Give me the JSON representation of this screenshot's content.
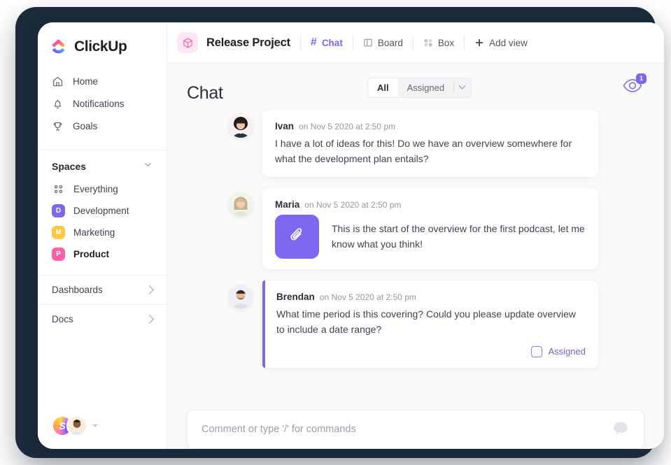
{
  "brand": {
    "name": "ClickUp",
    "accent": "#7b68ee",
    "pink": "#ff5fa8"
  },
  "sidebar": {
    "nav": [
      {
        "label": "Home",
        "icon": "home-icon"
      },
      {
        "label": "Notifications",
        "icon": "bell-icon"
      },
      {
        "label": "Goals",
        "icon": "trophy-icon"
      }
    ],
    "spaces_title": "Spaces",
    "spaces": [
      {
        "label": "Everything",
        "badge": "",
        "color": "",
        "icon": "grid-dots-icon",
        "active": false
      },
      {
        "label": "Development",
        "badge": "D",
        "color": "#7b68ee",
        "active": false
      },
      {
        "label": "Marketing",
        "badge": "M",
        "color": "#ffc93d",
        "active": false
      },
      {
        "label": "Product",
        "badge": "P",
        "color": "#ff5fa8",
        "active": true
      }
    ],
    "footer_links": [
      {
        "label": "Dashboards"
      },
      {
        "label": "Docs"
      }
    ],
    "user_avatar_initial": "S"
  },
  "topbar": {
    "project": "Release Project",
    "project_icon": "cube-icon",
    "tabs": [
      {
        "label": "Chat",
        "icon": "hash-icon",
        "active": true
      },
      {
        "label": "Board",
        "icon": "board-icon",
        "active": false
      },
      {
        "label": "Box",
        "icon": "box-grid-icon",
        "active": false
      }
    ],
    "add_view": "Add view"
  },
  "page": {
    "title": "Chat",
    "filters": [
      {
        "label": "All",
        "selected": true
      },
      {
        "label": "Assigned",
        "selected": false
      }
    ],
    "watchers": {
      "icon": "eye-icon",
      "count": "1"
    }
  },
  "messages": [
    {
      "author": "Ivan",
      "stamp": "on Nov 5 2020 at 2:50 pm",
      "text": "I have a lot of ideas for this! Do we have an overview somewhere for what the development plan entails?",
      "avatar_bg": "#fbeff1",
      "accent": false,
      "attachment": null,
      "assigned_label": null
    },
    {
      "author": "Maria",
      "stamp": "on Nov 5 2020 at 2:50 pm",
      "text": "This is the start of the overview for the first podcast, let me know what you think!",
      "avatar_bg": "#eef6e9",
      "accent": false,
      "attachment": {
        "icon": "paperclip-icon",
        "color": "#7b68ee"
      },
      "assigned_label": null
    },
    {
      "author": "Brendan",
      "stamp": "on Nov 5 2020 at 2:50 pm",
      "text": "What time period is this covering? Could you please update overview to include a date range?",
      "avatar_bg": "#f0eefb",
      "accent": true,
      "attachment": null,
      "assigned_label": "Assigned"
    }
  ],
  "composer": {
    "placeholder": "Comment or type '/' for commands",
    "icon": "chat-bubble-icon"
  }
}
